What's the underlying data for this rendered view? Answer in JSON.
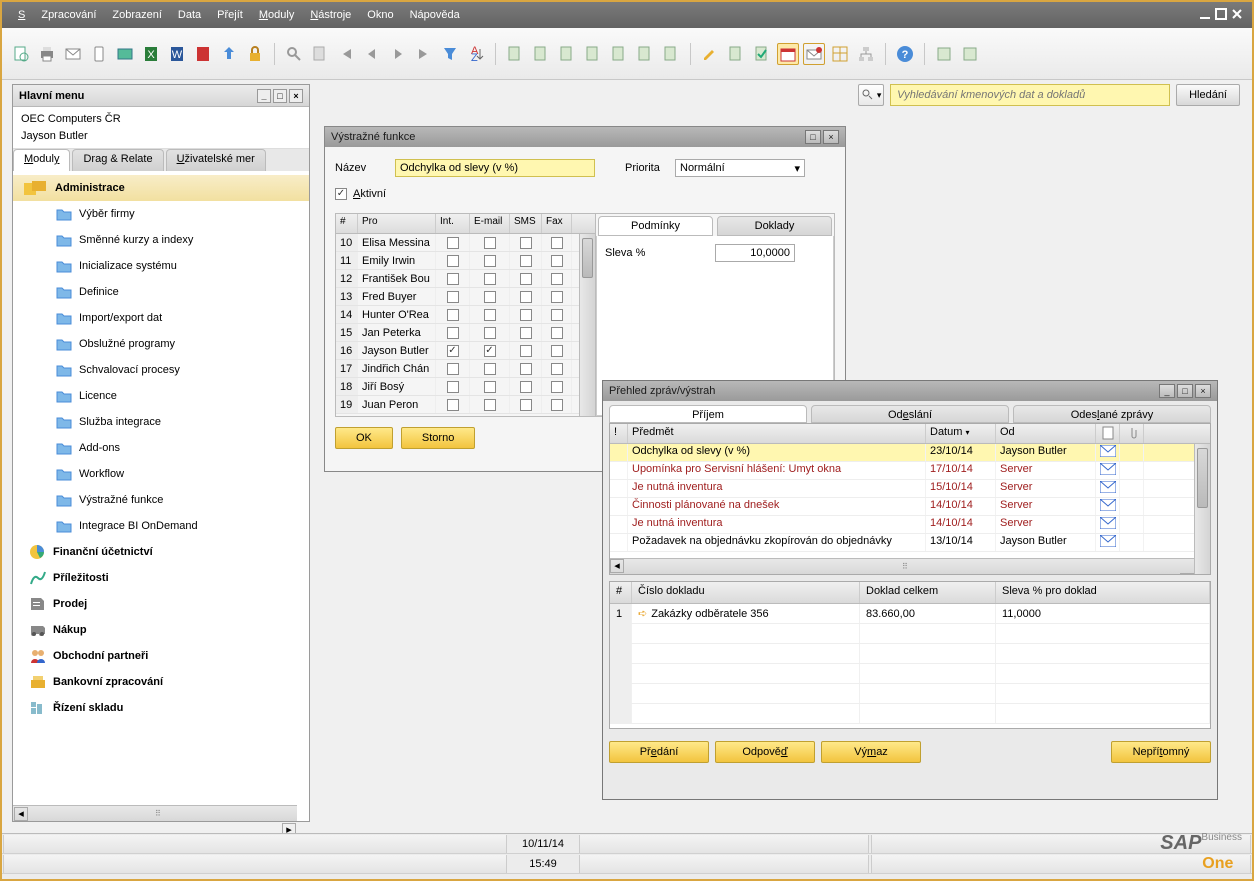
{
  "menu": [
    "Soubor",
    "Zpracování",
    "Zobrazení",
    "Data",
    "Přejít",
    "Moduly",
    "Nástroje",
    "Okno",
    "Nápověda"
  ],
  "search": {
    "placeholder": "Vyhledávání kmenových dat a dokladů",
    "button": "Hledání"
  },
  "main_panel": {
    "title": "Hlavní menu",
    "company": "OEC Computers ČR",
    "user": "Jayson Butler",
    "tabs": [
      "Moduly",
      "Drag & Relate",
      "Uživatelské menu"
    ],
    "root": "Administrace",
    "items": [
      "Výběr firmy",
      "Směnné kurzy a indexy",
      "Inicializace systému",
      "Definice",
      "Import/export dat",
      "Obslužné programy",
      "Schvalovací procesy",
      "Licence",
      "Služba integrace",
      "Add-ons",
      "Workflow",
      "Výstražné funkce",
      "Integrace BI OnDemand"
    ],
    "modules": [
      "Finanční účetnictví",
      "Příležitosti",
      "Prodej",
      "Nákup",
      "Obchodní partneři",
      "Bankovní zpracování",
      "Řízení skladu"
    ]
  },
  "alert_win": {
    "title": "Výstražné funkce",
    "name_label": "Název",
    "name_value": "Odchylka od slevy (v %)",
    "priority_label": "Priorita",
    "priority_value": "Normální",
    "active_label": "Aktivní",
    "active": true,
    "cols": [
      "#",
      "Pro",
      "Int.",
      "E-mail",
      "SMS",
      "Fax"
    ],
    "rows": [
      {
        "n": 10,
        "name": "Elisa Messina",
        "int": false,
        "email": false,
        "sms": false,
        "fax": false
      },
      {
        "n": 11,
        "name": "Emily Irwin",
        "int": false,
        "email": false,
        "sms": false,
        "fax": false
      },
      {
        "n": 12,
        "name": "František Bou",
        "int": false,
        "email": false,
        "sms": false,
        "fax": false
      },
      {
        "n": 13,
        "name": "Fred Buyer",
        "int": false,
        "email": false,
        "sms": false,
        "fax": false
      },
      {
        "n": 14,
        "name": "Hunter O'Rea",
        "int": false,
        "email": false,
        "sms": false,
        "fax": false
      },
      {
        "n": 15,
        "name": "Jan Peterka",
        "int": false,
        "email": false,
        "sms": false,
        "fax": false
      },
      {
        "n": 16,
        "name": "Jayson Butler",
        "int": true,
        "email": true,
        "sms": false,
        "fax": false
      },
      {
        "n": 17,
        "name": "Jindřich Chán",
        "int": false,
        "email": false,
        "sms": false,
        "fax": false
      },
      {
        "n": 18,
        "name": "Jiří Bosý",
        "int": false,
        "email": false,
        "sms": false,
        "fax": false
      },
      {
        "n": 19,
        "name": "Juan Peron",
        "int": false,
        "email": false,
        "sms": false,
        "fax": false
      }
    ],
    "rtabs": [
      "Podmínky",
      "Doklady"
    ],
    "cond_label": "Sleva %",
    "cond_value": "10,0000",
    "ok": "OK",
    "cancel": "Storno"
  },
  "msg_win": {
    "title": "Přehled zpráv/výstrah",
    "tabs": [
      "Příjem",
      "Odeslání",
      "Odeslané zprávy"
    ],
    "cols": {
      "subject": "Předmět",
      "date": "Datum",
      "from": "Od"
    },
    "rows": [
      {
        "subject": "Odchylka od slevy (v %)",
        "date": "23/10/14",
        "from": "Jayson Butler",
        "sel": true,
        "unread": false
      },
      {
        "subject": "Upomínka pro Servisní hlášení: Umyt okna",
        "date": "17/10/14",
        "from": "Server",
        "unread": true
      },
      {
        "subject": "Je nutná inventura",
        "date": "15/10/14",
        "from": "Server",
        "unread": true
      },
      {
        "subject": "Činnosti plánované na dnešek",
        "date": "14/10/14",
        "from": "Server",
        "unread": true
      },
      {
        "subject": "Je nutná inventura",
        "date": "14/10/14",
        "from": "Server",
        "unread": true
      },
      {
        "subject": "Požadavek na objednávku zkopírován do objednávky",
        "date": "13/10/14",
        "from": "Jayson Butler",
        "unread": false
      }
    ],
    "doc_cols": {
      "n": "#",
      "docno": "Číslo dokladu",
      "total": "Doklad celkem",
      "disc": "Sleva % pro doklad"
    },
    "doc_rows": [
      {
        "n": 1,
        "docno": "Zakázky odběratele 356",
        "total": "83.660,00",
        "disc": "11,0000"
      }
    ],
    "btns": [
      "Předání",
      "Odpověď",
      "Výmaz",
      "Nepřítomný"
    ]
  },
  "status": {
    "date": "10/11/14",
    "time": "15:49"
  }
}
